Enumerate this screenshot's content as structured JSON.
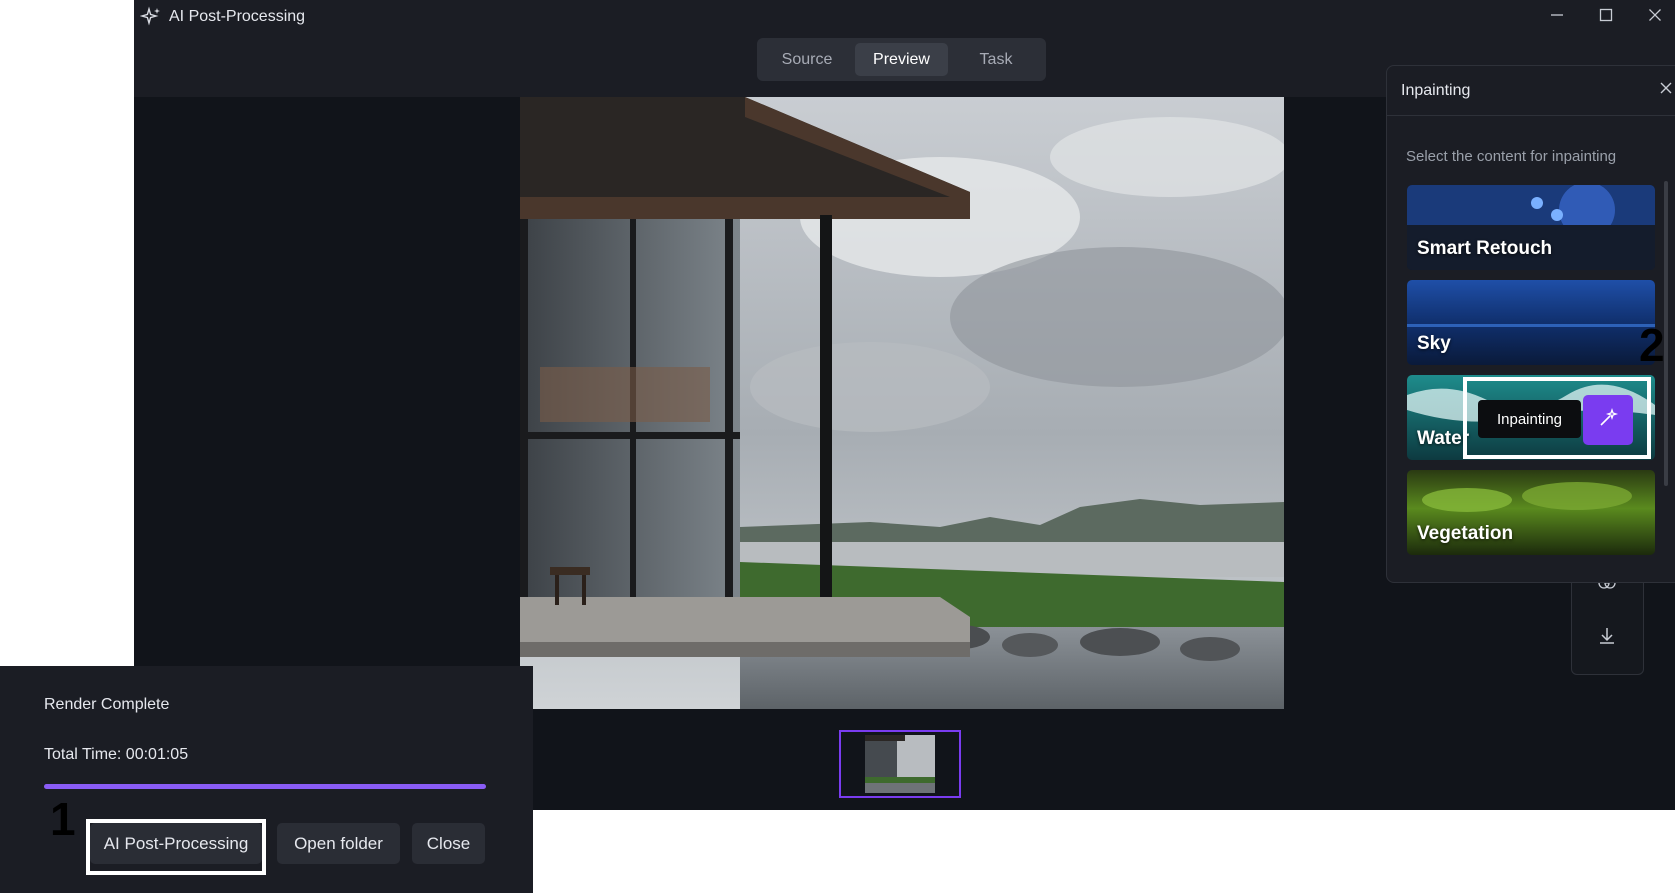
{
  "app": {
    "title": "AI Post-Processing"
  },
  "tabs": [
    {
      "label": "Source"
    },
    {
      "label": "Preview"
    },
    {
      "label": "Task"
    }
  ],
  "inpainting_panel": {
    "title": "Inpainting",
    "hint": "Select the content for inpainting",
    "options": [
      {
        "label": "Smart Retouch"
      },
      {
        "label": "Sky"
      },
      {
        "label": "Water"
      },
      {
        "label": "Vegetation"
      }
    ]
  },
  "tooltip": {
    "text": "Inpainting"
  },
  "annotations": {
    "one": "1",
    "two": "2"
  },
  "status": {
    "title": "Render Complete",
    "total_time": "Total Time: 00:01:05",
    "progress": 1.0,
    "buttons": {
      "post_processing": "AI Post-Processing",
      "open_folder": "Open folder",
      "close": "Close"
    }
  },
  "colors": {
    "accent": "#7a3cf0",
    "progress": "#8a5cf6",
    "window_bg": "#1b1d24",
    "viewport_bg": "#11141a"
  }
}
